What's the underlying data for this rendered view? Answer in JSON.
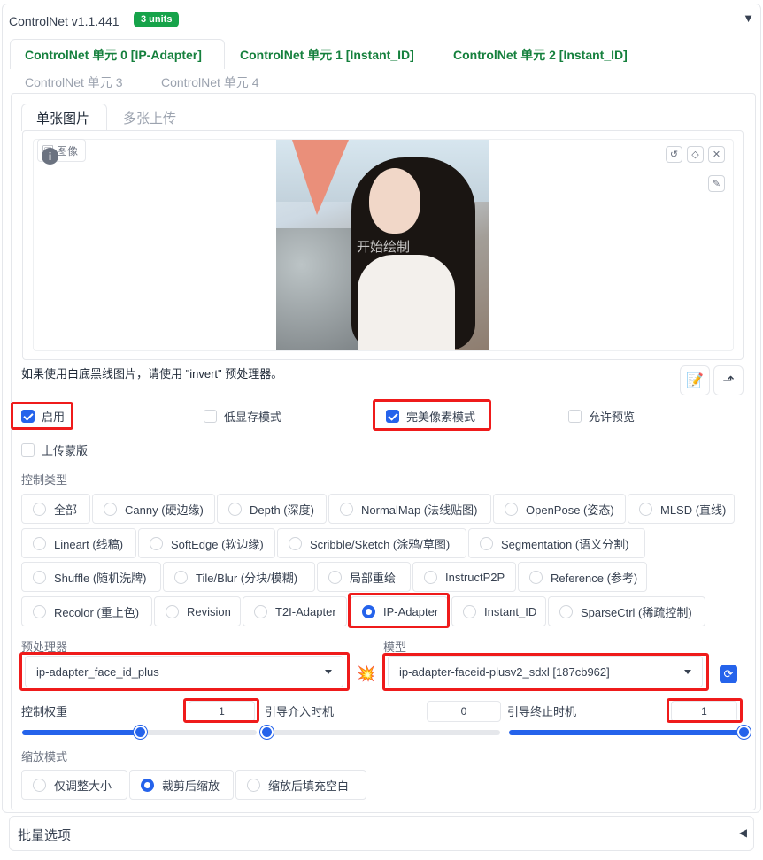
{
  "header": {
    "title": "ControlNet v1.1.441",
    "badge": "3 units",
    "collapse_icon": "▼"
  },
  "unit_tabs": [
    "ControlNet 单元 0 [IP-Adapter]",
    "ControlNet 单元 1 [Instant_ID]",
    "ControlNet 单元 2 [Instant_ID]",
    "ControlNet 单元 3",
    "ControlNet 单元 4"
  ],
  "image_tabs": [
    "单张图片",
    "多张上传"
  ],
  "image": {
    "label": "图像",
    "watermark": "开始绘制"
  },
  "hint": "如果使用白底黑线图片，请使用 \"invert\" 预处理器。",
  "checkboxes": {
    "enable": "启用",
    "low_vram": "低显存模式",
    "pixel_perfect": "完美像素模式",
    "allow_preview": "允许预览",
    "upload_mask": "上传蒙版"
  },
  "control_type": {
    "label": "控制类型",
    "options": [
      "全部",
      "Canny (硬边缘)",
      "Depth (深度)",
      "NormalMap (法线贴图)",
      "OpenPose (姿态)",
      "MLSD (直线)",
      "Lineart (线稿)",
      "SoftEdge (软边缘)",
      "Scribble/Sketch (涂鸦/草图)",
      "Segmentation (语义分割)",
      "Shuffle (随机洗牌)",
      "Tile/Blur (分块/模糊)",
      "局部重绘",
      "InstructP2P",
      "Reference (参考)",
      "Recolor (重上色)",
      "Revision",
      "T2I-Adapter",
      "IP-Adapter",
      "Instant_ID",
      "SparseCtrl (稀疏控制)"
    ],
    "selected": "IP-Adapter"
  },
  "preprocessor": {
    "label": "预处理器",
    "value": "ip-adapter_face_id_plus"
  },
  "model": {
    "label": "模型",
    "value": "ip-adapter-faceid-plusv2_sdxl [187cb962]"
  },
  "weight": {
    "label": "控制权重",
    "value": "1",
    "fraction": 0.5
  },
  "start": {
    "label": "引导介入时机",
    "value": "0",
    "fraction": 0
  },
  "end": {
    "label": "引导终止时机",
    "value": "1",
    "fraction": 1
  },
  "resize": {
    "label": "缩放模式",
    "options": [
      "仅调整大小",
      "裁剪后缩放",
      "缩放后填充空白"
    ],
    "selected": "裁剪后缩放"
  },
  "batch": {
    "label": "批量选项",
    "arrow": "◀"
  },
  "colors": {
    "accent": "#2563eb",
    "green": "#15803d",
    "highlight": "#ef1b1b"
  }
}
